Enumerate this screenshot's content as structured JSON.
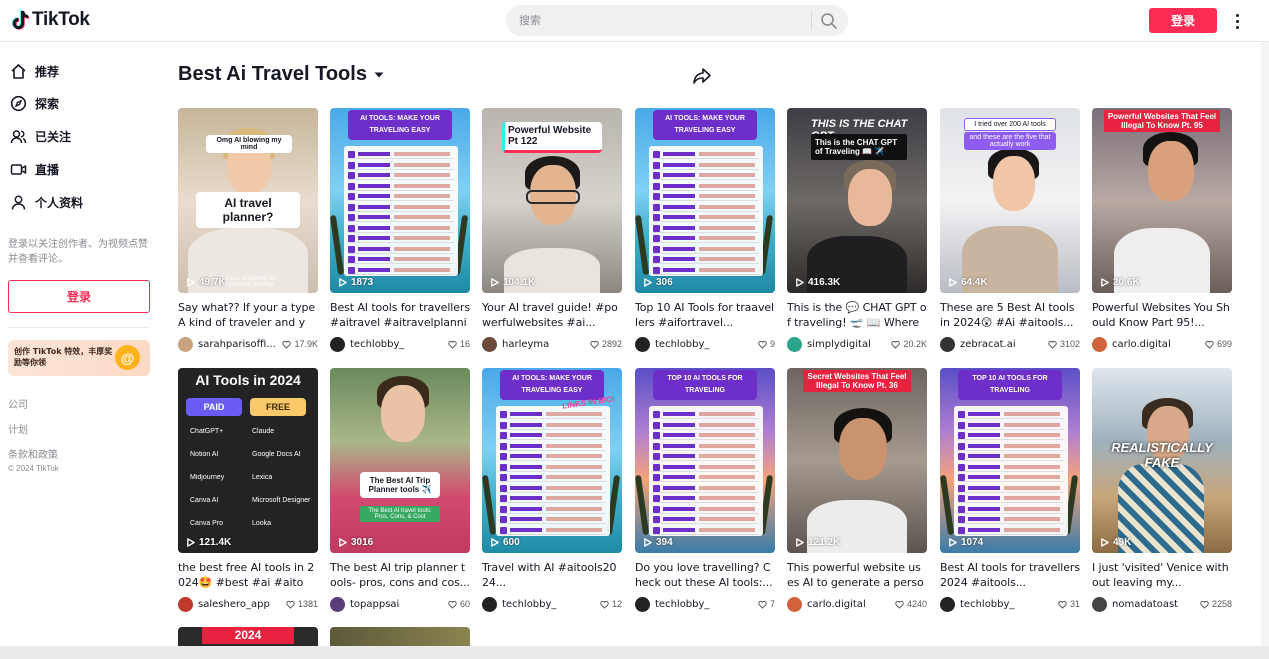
{
  "header": {
    "logo_text": "TikTok",
    "search_placeholder": "搜索",
    "login_label": "登录"
  },
  "sidebar": {
    "items": [
      {
        "label": "推荐",
        "icon": "home-icon"
      },
      {
        "label": "探索",
        "icon": "compass-icon"
      },
      {
        "label": "已关注",
        "icon": "following-icon"
      },
      {
        "label": "直播",
        "icon": "live-icon"
      },
      {
        "label": "个人资料",
        "icon": "profile-icon"
      }
    ],
    "hint": "登录以关注创作者、为视频点赞并查看评论。",
    "login_label": "登录",
    "promo_text": "创作 TikTok 特效，丰厚奖励等你领",
    "promo_badge": "@",
    "footer_links": [
      "公司",
      "计划",
      "条款和政策"
    ],
    "copyright": "© 2024 TikTok"
  },
  "main": {
    "title": "Best Ai Travel Tools",
    "cards": [
      {
        "views": "49.7K",
        "caption": "Say what?? If your a type A kind of traveler and yo...",
        "author": "sarahparisoffi...",
        "likes": "17.9K",
        "overlay_top": "Omg AI blowing my mind",
        "overlay_main": "AI travel planner?",
        "overlay_bottom": "for use preparing for travel this summer",
        "avatar_color": "#c9a27e"
      },
      {
        "views": "1873",
        "caption": "Best AI tools for travellers #aitravel #aitravelplannin...",
        "author": "techlobby_",
        "likes": "16",
        "banner": "AI TOOLS: MAKE YOUR TRAVELING EASY",
        "avatar_color": "#222222"
      },
      {
        "views": "104.1K",
        "caption": "Your AI travel guide! #powerfulwebsites #ai...",
        "author": "harleyma",
        "likes": "2892",
        "overlay_main": "Powerful Website Pt 122",
        "avatar_color": "#6b4a3a"
      },
      {
        "views": "306",
        "caption": "Top 10 AI Tools for traavellers #aifortravel...",
        "author": "techlobby_",
        "likes": "9",
        "banner": "AI TOOLS: MAKE YOUR TRAVELING EASY",
        "avatar_color": "#222222"
      },
      {
        "views": "416.3K",
        "caption": "This is the 💬 CHAT GPT of traveling! 🛫 📖 Where a...",
        "author": "simplydigital",
        "likes": "20.2K",
        "overlay_top": "THIS IS THE CHAT GPT",
        "overlay_main": "This is the CHAT GPT of Traveling 📖 ✈️",
        "avatar_color": "#2aa58b"
      },
      {
        "views": "64.4K",
        "caption": "These are 5 Best AI tools in 2024😲 #Ai #aitools...",
        "author": "zebracat.ai",
        "likes": "3102",
        "overlay_main": "I tried over 200 AI tools",
        "overlay_bottom": "and these are the five that actually work",
        "avatar_color": "#333333"
      },
      {
        "views": "20.6K",
        "caption": "Powerful Websites You Should Know Part 95!...",
        "author": "carlo.digital",
        "likes": "699",
        "overlay_main": "Powerful Websites That Feel Illegal To Know Pt. 95",
        "avatar_color": "#d0633a"
      },
      {
        "views": "121.4K",
        "caption": "the best free AI tools in 2024🤩 #best #ai #aitoo...",
        "author": "saleshero_app",
        "likes": "1381",
        "banner": "AI Tools in 2024",
        "paid": "PAID",
        "free": "FREE",
        "paid_tools": [
          "ChatGPT+",
          "Notion AI",
          "Midjourney",
          "Canva AI",
          "Canva Pro"
        ],
        "free_tools": [
          "Claude",
          "Google Docs AI",
          "Lexica",
          "Microsoft Designer",
          "Looka"
        ],
        "avatar_color": "#c0392b"
      },
      {
        "views": "3016",
        "caption": "The best AI trip planner tools- pros, cons and cos...",
        "author": "topappsai",
        "likes": "60",
        "overlay_main": "The Best AI Trip Planner tools ✈️",
        "overlay_bottom": "The Best AI travel tools: Pros, Cons, & Cost",
        "avatar_color": "#5a3e7a"
      },
      {
        "views": "600",
        "caption": "Travel with AI #aitools2024...",
        "author": "techlobby_",
        "likes": "12",
        "banner": "AI TOOLS: MAKE YOUR TRAVELING EASY",
        "overlay_bottom": "LINKS IN BIO!",
        "avatar_color": "#222222"
      },
      {
        "views": "394",
        "caption": "Do you love travelling? Check out these AI tools:...",
        "author": "techlobby_",
        "likes": "7",
        "banner": "TOP 10 AI TOOLS FOR TRAVELING",
        "avatar_color": "#222222"
      },
      {
        "views": "121.2K",
        "caption": "This powerful website uses AI to generate a personal...",
        "author": "carlo.digital",
        "likes": "4240",
        "overlay_main": "Secret Websites That Feel Illegal To Know Pt. 36",
        "avatar_color": "#d0633a"
      },
      {
        "views": "1074",
        "caption": "Best AI tools for travellers 2024 #aitools...",
        "author": "techlobby_",
        "likes": "31",
        "banner": "TOP 10 AI TOOLS FOR TRAVELING",
        "avatar_color": "#222222"
      },
      {
        "views": "49K",
        "caption": "I just 'visited' Venice without leaving my...",
        "author": "nomadatoast",
        "likes": "2258",
        "overlay_main": "REALISTICALLY FAKE",
        "avatar_color": "#444444"
      }
    ],
    "partial_card_label": "2024"
  },
  "colors": {
    "brand": "#fe2c55",
    "text": "#161823",
    "muted": "#8a8b91"
  }
}
